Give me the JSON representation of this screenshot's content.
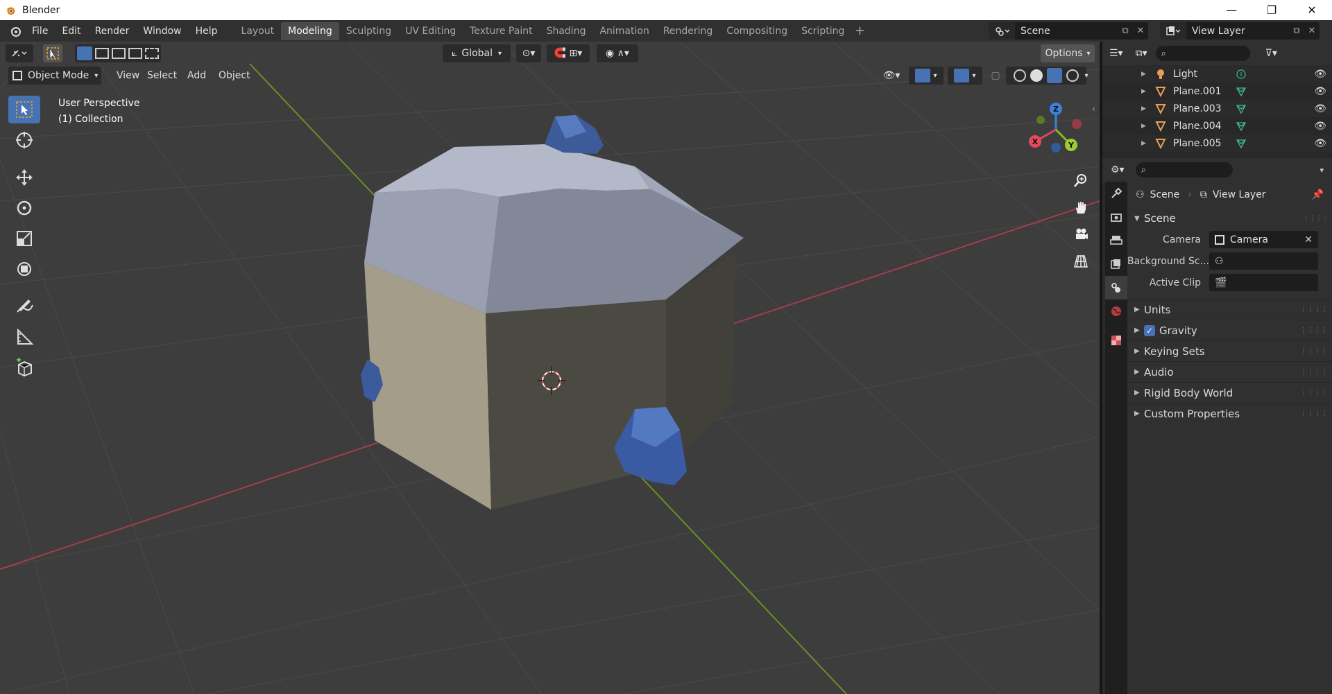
{
  "window": {
    "title": "Blender",
    "controls": [
      "—",
      "❐",
      "✕"
    ]
  },
  "menu": [
    "File",
    "Edit",
    "Render",
    "Window",
    "Help"
  ],
  "workspaces": [
    {
      "label": "Layout",
      "active": false
    },
    {
      "label": "Modeling",
      "active": true
    },
    {
      "label": "Sculpting",
      "active": false
    },
    {
      "label": "UV Editing",
      "active": false
    },
    {
      "label": "Texture Paint",
      "active": false
    },
    {
      "label": "Shading",
      "active": false
    },
    {
      "label": "Animation",
      "active": false
    },
    {
      "label": "Rendering",
      "active": false
    },
    {
      "label": "Compositing",
      "active": false
    },
    {
      "label": "Scripting",
      "active": false
    }
  ],
  "scene_selector": "Scene",
  "view_layer_selector": "View Layer",
  "viewport": {
    "orientation": "Global",
    "options_label": "Options",
    "mode": "Object Mode",
    "menus": [
      "View",
      "Select",
      "Add",
      "Object"
    ],
    "perspective": "User Perspective",
    "collection": "(1) Collection",
    "gizmo_axes": {
      "x": "X",
      "y": "Y",
      "z": "Z"
    }
  },
  "outliner": {
    "rows": [
      {
        "name": "Light",
        "type": "light"
      },
      {
        "name": "Plane.001",
        "type": "mesh"
      },
      {
        "name": "Plane.003",
        "type": "mesh"
      },
      {
        "name": "Plane.004",
        "type": "mesh"
      },
      {
        "name": "Plane.005",
        "type": "mesh"
      }
    ]
  },
  "properties": {
    "breadcrumb_scene": "Scene",
    "breadcrumb_view_layer": "View Layer",
    "scene_panel": "Scene",
    "camera_label": "Camera",
    "camera_value": "Camera",
    "background_label": "Background Sc...",
    "active_clip_label": "Active Clip",
    "sections": [
      "Units",
      "Gravity",
      "Keying Sets",
      "Audio",
      "Rigid Body World",
      "Custom Properties"
    ],
    "gravity_checked": true
  },
  "colors": {
    "accent": "#4772b3",
    "viewport_bg": "#3d3d3d",
    "axis_x": "#c64553",
    "axis_y": "#7ba32a",
    "axis_z": "#3b82d9"
  }
}
